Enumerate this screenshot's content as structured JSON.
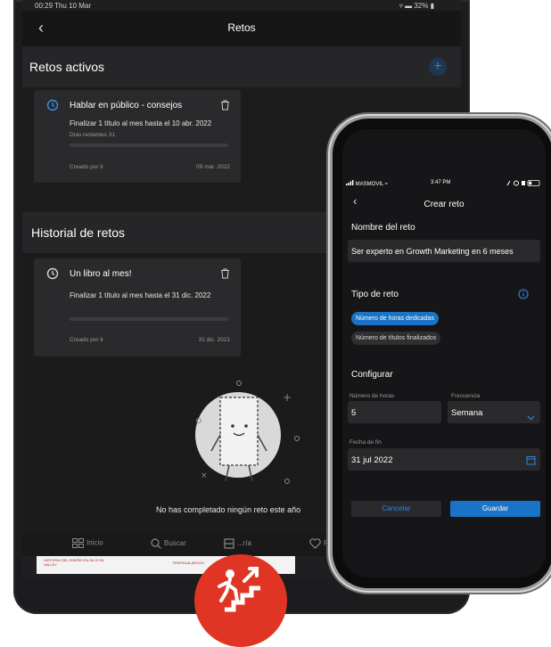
{
  "tablet": {
    "status_time": "00:29  Thu 10 Mar",
    "status_right": "▿ ▬ 32% ▮",
    "nav_title": "Retos",
    "active_section": "Retos activos",
    "history_section": "Historial de retos",
    "active_card": {
      "title": "Hablar en público - consejos",
      "desc": "Finalizar 1 título al mes hasta el 10 abr. 2022",
      "days": "Días restantes 31",
      "creator": "Creado por ti",
      "date": "09 mar. 2022",
      "progress": 0
    },
    "history_card": {
      "title": "Un libro al mes!",
      "desc": "Finalizar 1 título al mes hasta el 31 dic. 2022",
      "creator": "Creado por ti",
      "date": "31 dic. 2021",
      "progress": 0
    },
    "empty_text": "No has completado ningún reto este año",
    "bottom_nav": [
      "Inicio",
      "Buscar",
      "...ría",
      "Favo..."
    ],
    "book_strip": [
      "HISTORIA DEL DISEÑO EN SILICON VALLEY",
      "TERESA ALARCOS"
    ]
  },
  "phone": {
    "carrier": "MASMOVIL",
    "time": "3:47 PM",
    "title": "Crear reto",
    "name_label": "Nombre del reto",
    "name_value": "Ser experto en Growth Marketing en 6 meses",
    "type_label": "Tipo de reto",
    "type_options": [
      "Número de horas dedicadas",
      "Número de títulos finalizados"
    ],
    "configure_label": "Configurar",
    "hours_label": "Número de horas",
    "hours_value": "5",
    "freq_label": "Frecuencia",
    "freq_value": "Semana",
    "end_label": "Fecha de fin",
    "end_value": "31 jul 2022",
    "cancel": "Cancelar",
    "save": "Guardar"
  },
  "colors": {
    "accent": "#1a73c6",
    "brand_red": "#e03524"
  }
}
